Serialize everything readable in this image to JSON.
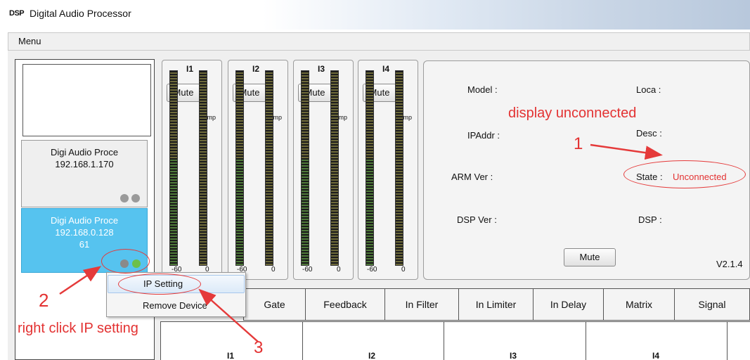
{
  "window": {
    "app_icon": "DSP",
    "title": "Digital Audio Processor"
  },
  "menubar": {
    "menu": "Menu"
  },
  "devices": [
    {
      "name": "Digi Audio Proce",
      "ip": "192.168.1.170",
      "extra": ""
    },
    {
      "name": "Digi Audio Proce",
      "ip": "192.168.0.128",
      "extra": "61"
    }
  ],
  "channels": [
    {
      "label": "I1",
      "mute": "Mute",
      "comp": "Comp",
      "scale_low": "-60",
      "scale_high": "0"
    },
    {
      "label": "I2",
      "mute": "Mute",
      "comp": "Comp",
      "scale_low": "-60",
      "scale_high": "0"
    },
    {
      "label": "I3",
      "mute": "Mute",
      "comp": "Comp",
      "scale_low": "-60",
      "scale_high": "0"
    },
    {
      "label": "I4",
      "mute": "Mute",
      "comp": "Comp",
      "scale_low": "-60",
      "scale_high": "0"
    }
  ],
  "info": {
    "model": "Model :",
    "loca": "Loca :",
    "ipaddr": "IPAddr :",
    "desc": "Desc :",
    "arm_ver": "ARM Ver :",
    "state_label": "State :",
    "state_value": "Unconnected",
    "dsp_ver": "DSP Ver :",
    "dsp": "DSP :",
    "mute": "Mute",
    "version": "V2.1.4"
  },
  "tabs": [
    "Gate",
    "Feedback",
    "In Filter",
    "In Limiter",
    "In Delay",
    "Matrix",
    "Signal"
  ],
  "bottom_labels": [
    "I1",
    "I2",
    "I3",
    "I4"
  ],
  "context_menu": [
    "IP Setting",
    "Remove Device"
  ],
  "annotations": {
    "display_unconnected": "display unconnected",
    "num1": "1",
    "num2": "2",
    "num3": "3",
    "right_click": "right click IP setting"
  },
  "colors": {
    "annotation": "#e33232",
    "selected_device": "#56c3ef",
    "status_dot_gray": "#8a8a8a",
    "status_dot_green": "#6cc04a"
  }
}
